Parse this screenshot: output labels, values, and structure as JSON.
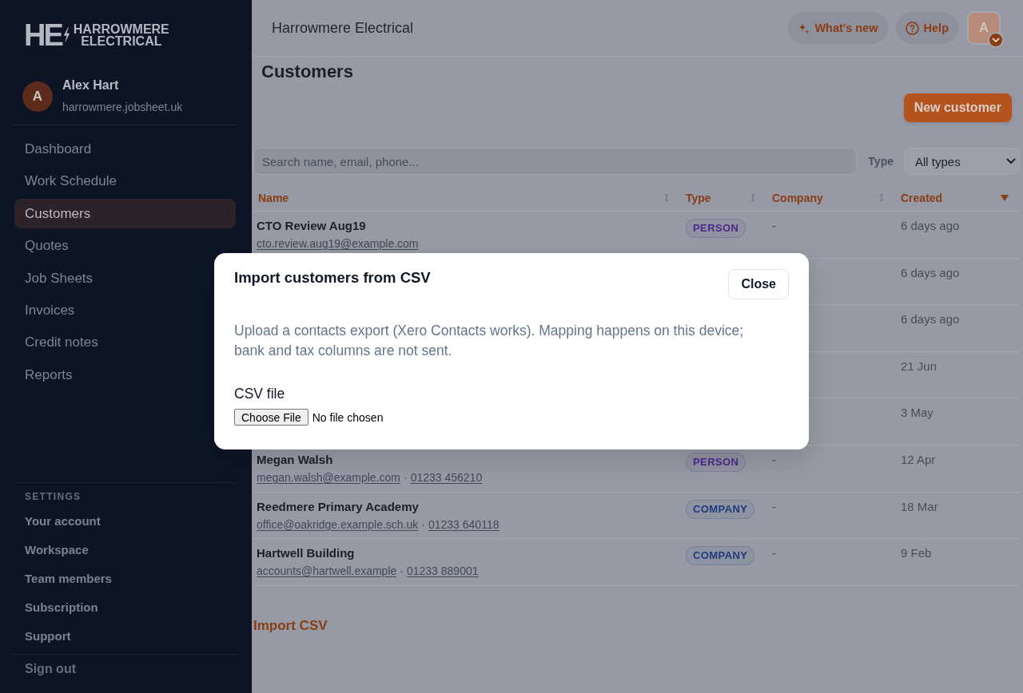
{
  "sidebar": {
    "logo": {
      "mark": "HE",
      "name_lines": [
        "HARROWMERE",
        "ELECTRICAL"
      ]
    },
    "user": {
      "initial": "A",
      "name": "Alex Hart",
      "workspace": "harrowmere.jobsheet.uk"
    },
    "nav": [
      {
        "label": "Dashboard",
        "selected": false
      },
      {
        "label": "Work Schedule",
        "selected": false
      },
      {
        "label": "Customers",
        "selected": true
      },
      {
        "label": "Quotes",
        "selected": false
      },
      {
        "label": "Job Sheets",
        "selected": false
      },
      {
        "label": "Invoices",
        "selected": false
      },
      {
        "label": "Credit notes",
        "selected": false
      },
      {
        "label": "Reports",
        "selected": false
      }
    ],
    "settings": {
      "heading": "SETTINGS",
      "items": [
        "Your account",
        "Workspace",
        "Team members",
        "Subscription",
        "Support"
      ]
    },
    "sign_out": "Sign out"
  },
  "topbar": {
    "title": "Harrowmere Electrical",
    "buttons": [
      {
        "label": "What's new",
        "kind": "sparkle"
      },
      {
        "label": "Help",
        "kind": "help"
      }
    ],
    "avatar": {
      "initial": "A"
    }
  },
  "page": {
    "title": "Customers",
    "new_button": "New customer"
  },
  "filters": {
    "search": {
      "placeholder": "Search name, email, phone..."
    },
    "type": {
      "label": "Type",
      "value": "All types"
    }
  },
  "table": {
    "columns": [
      {
        "label": "Name",
        "sorted": false
      },
      {
        "label": "Type",
        "sorted": false
      },
      {
        "label": "Company",
        "sorted": false
      },
      {
        "label": "Created",
        "sorted": true
      }
    ],
    "contact_separator": "·",
    "rows": [
      {
        "name": "CTO Review Aug19",
        "email": "cto.review.aug19@example.com",
        "type": {
          "label": "PERSON",
          "color": "#4b2a8c"
        },
        "company": "-",
        "created": "6 days ago"
      },
      {
        "created": "6 days ago"
      },
      {
        "created": "6 days ago"
      },
      {
        "created": "21 Jun"
      },
      {
        "created": "3 May"
      },
      {
        "name": "Megan Walsh",
        "email": "megan.walsh@example.com",
        "phone": "01233 456210",
        "type": {
          "label": "PERSON",
          "color": "#4b2a8c"
        },
        "company": "-",
        "created": "12 Apr"
      },
      {
        "name": "Reedmere Primary Academy",
        "email": "office@oakridge.example.sch.uk",
        "phone": "01233 640118",
        "type": {
          "label": "COMPANY",
          "color": "#1f3a7c"
        },
        "company": "-",
        "created": "18 Mar"
      },
      {
        "name": "Hartwell Building",
        "email": "accounts@hartwell.example",
        "phone": "01233 889001",
        "type": {
          "label": "COMPANY",
          "color": "#1f3a7c"
        },
        "company": "-",
        "created": "9 Feb"
      }
    ]
  },
  "import_link": "Import CSV",
  "modal": {
    "title": "Import customers from CSV",
    "close": "Close",
    "description": "Upload a contacts export (Xero Contacts works). Mapping happens on this device; bank and tax columns are not sent.",
    "file_field": {
      "label": "CSV file",
      "button": "Choose File",
      "status": "No file chosen"
    }
  }
}
